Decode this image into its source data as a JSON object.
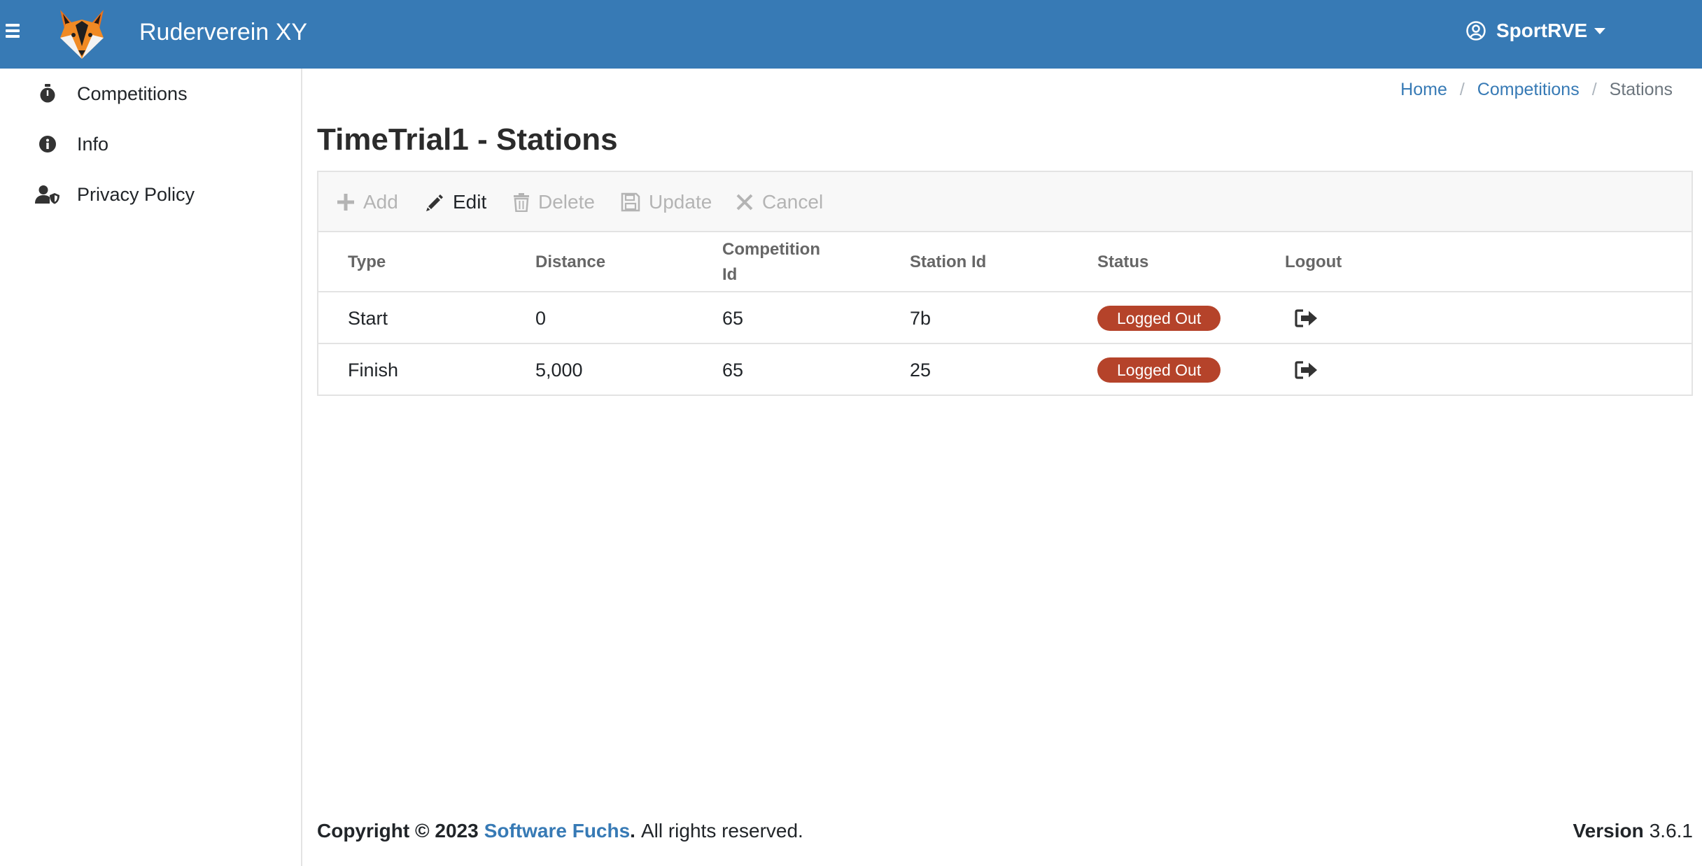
{
  "header": {
    "app_title": "Ruderverein XY",
    "user_name": "SportRVE",
    "brand_color": "#377ab5"
  },
  "sidebar": {
    "items": [
      {
        "label": "Competitions",
        "icon": "stopwatch-icon"
      },
      {
        "label": "Info",
        "icon": "info-circle-icon"
      },
      {
        "label": "Privacy Policy",
        "icon": "user-shield-icon"
      }
    ]
  },
  "breadcrumb": {
    "home": "Home",
    "sep1": "/",
    "competitions": "Competitions",
    "sep2": "/",
    "current": "Stations"
  },
  "page": {
    "title": "TimeTrial1 - Stations"
  },
  "toolbar": {
    "add": "Add",
    "edit": "Edit",
    "delete": "Delete",
    "update": "Update",
    "cancel": "Cancel"
  },
  "table": {
    "columns": {
      "type": "Type",
      "distance": "Distance",
      "competition_id_1": "Competition",
      "competition_id_2": "Id",
      "station_id": "Station Id",
      "status": "Status",
      "logout": "Logout"
    },
    "rows": [
      {
        "type": "Start",
        "distance": "0",
        "competition_id": "65",
        "station_id": "7b",
        "status": "Logged Out"
      },
      {
        "type": "Finish",
        "distance": "5,000",
        "competition_id": "65",
        "station_id": "25",
        "status": "Logged Out"
      }
    ],
    "status_color": "#b5432a"
  },
  "footer": {
    "copyright": "Copyright © 2023",
    "company": "Software Fuchs",
    "period": ".",
    "rights": "All rights reserved.",
    "version_label": "Version",
    "version_number": "3.6.1"
  }
}
